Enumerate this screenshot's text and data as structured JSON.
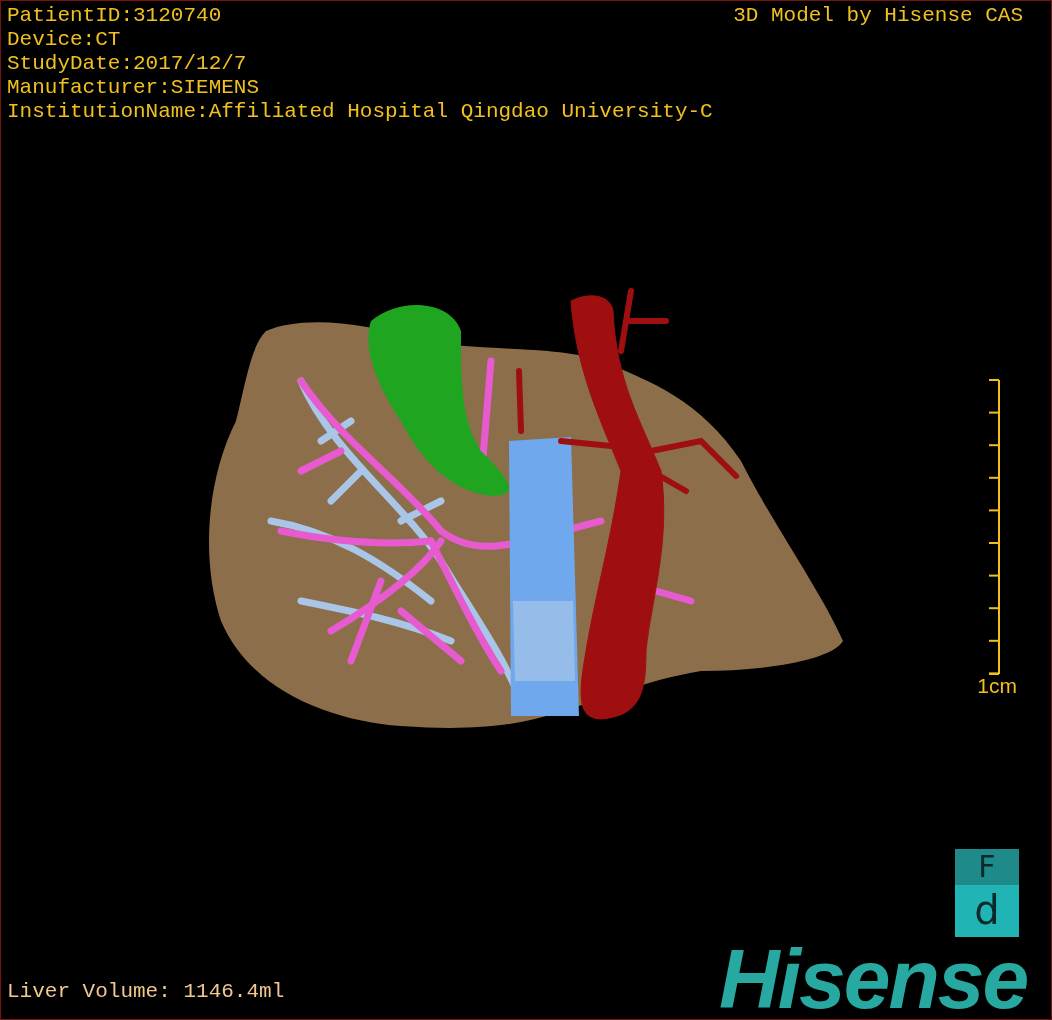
{
  "info_lines": [
    "PatientID:3120740",
    "Device:CT",
    "StudyDate:2017/12/7",
    "Manufacturer:SIEMENS",
    "InstitutionName:Affiliated Hospital Qingdao University-C"
  ],
  "credit": "3D Model by Hisense CAS",
  "scale": {
    "label": "1cm"
  },
  "liver_volume": "Liver Volume: 1146.4ml",
  "logo": {
    "badge_top": "F",
    "badge_bottom": "d",
    "wordmark": "Hisense"
  }
}
